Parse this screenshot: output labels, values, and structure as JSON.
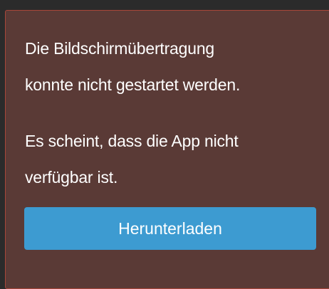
{
  "dialog": {
    "message_lines": [
      "Die Bildschirmübertragung",
      "konnte nicht gestartet werden."
    ],
    "detail_lines": [
      "Es scheint, dass die App nicht",
      "verfügbar ist."
    ],
    "download_label": "Herunterladen"
  },
  "colors": {
    "panel_background": "#5a3a36",
    "panel_border": "#a8463a",
    "button_background": "#3d9bd1",
    "text": "#ffffff"
  }
}
